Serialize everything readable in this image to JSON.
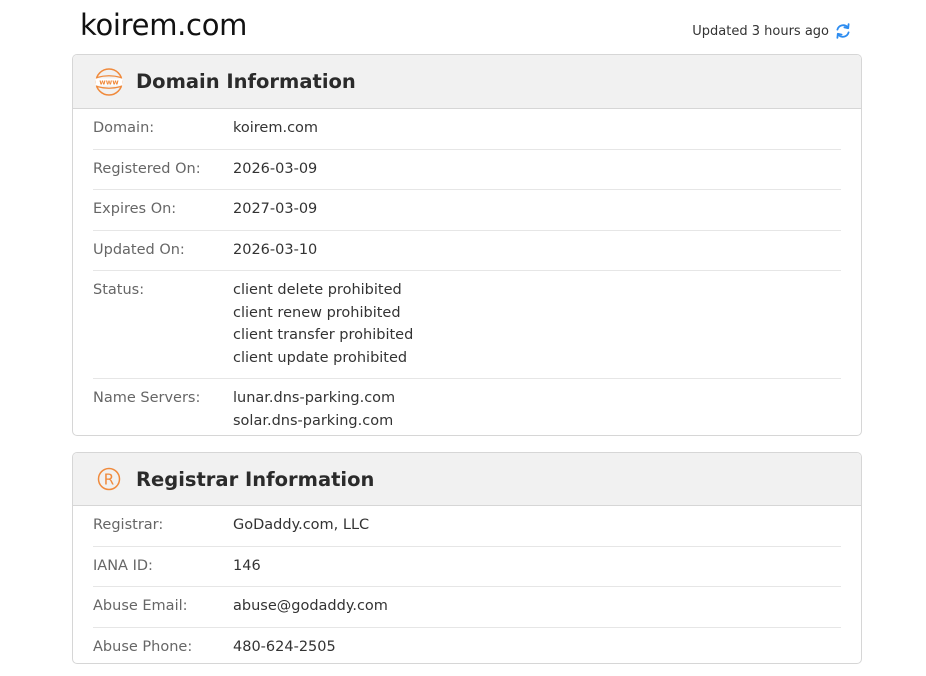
{
  "header": {
    "domain": "koirem.com",
    "updated_text": "Updated 3 hours ago"
  },
  "colors": {
    "accent_orange": "#f08a3c",
    "refresh_blue": "#2d8cf0"
  },
  "icons": {
    "domain_panel": "www-globe-icon",
    "registrar_panel": "registered-mark-icon",
    "refresh": "refresh-icon"
  },
  "domain_info": {
    "title": "Domain Information",
    "rows": [
      {
        "label": "Domain:",
        "values": [
          "koirem.com"
        ]
      },
      {
        "label": "Registered On:",
        "values": [
          "2026-03-09"
        ]
      },
      {
        "label": "Expires On:",
        "values": [
          "2027-03-09"
        ]
      },
      {
        "label": "Updated On:",
        "values": [
          "2026-03-10"
        ]
      },
      {
        "label": "Status:",
        "values": [
          "client delete prohibited",
          "client renew prohibited",
          "client transfer prohibited",
          "client update prohibited"
        ]
      },
      {
        "label": "Name Servers:",
        "values": [
          "lunar.dns-parking.com",
          "solar.dns-parking.com"
        ]
      }
    ]
  },
  "registrar_info": {
    "title": "Registrar Information",
    "rows": [
      {
        "label": "Registrar:",
        "values": [
          "GoDaddy.com, LLC"
        ]
      },
      {
        "label": "IANA ID:",
        "values": [
          "146"
        ]
      },
      {
        "label": "Abuse Email:",
        "values": [
          "abuse@godaddy.com"
        ]
      },
      {
        "label": "Abuse Phone:",
        "values": [
          "480-624-2505"
        ]
      }
    ]
  }
}
